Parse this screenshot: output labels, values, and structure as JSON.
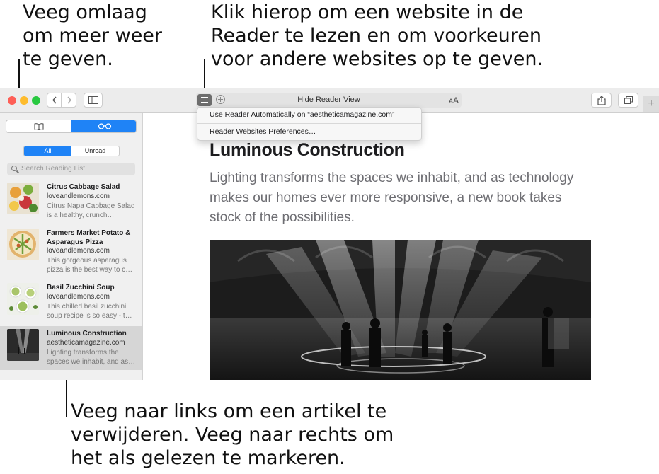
{
  "callouts": {
    "top_left": "Veeg omlaag om meer weer te geven.",
    "top_center": "Klik hierop om een website in de Reader te lezen en om voorkeuren voor andere websites op te geven.",
    "bottom": "Veeg naar links om een artikel te verwijderen. Veeg naar rechts om het als gelezen te markeren."
  },
  "toolbar": {
    "address_title": "Hide Reader View",
    "text_size_label": "AA",
    "icons": [
      "back-icon",
      "forward-icon",
      "sidebar-icon",
      "reader-icon",
      "add-icon",
      "share-icon",
      "tabs-icon",
      "new-tab-icon"
    ],
    "traffic_colors": {
      "close": "#fe5f57",
      "minimize": "#febc2e",
      "zoom": "#28c840"
    }
  },
  "reader_menu": {
    "items": [
      "Use Reader Automatically on “aestheticamagazine.com”",
      "Reader Websites Preferences…"
    ]
  },
  "sidebar": {
    "tabs": [
      "bookmarks-icon",
      "reading-list-icon"
    ],
    "filter": {
      "all": "All",
      "unread": "Unread"
    },
    "search_placeholder": "Search Reading List",
    "items": [
      {
        "title": "Citrus Cabbage Salad",
        "site": "loveandlemons.com",
        "excerpt": "Citrus Napa Cabbage Salad is a healthy, crunch…"
      },
      {
        "title": "Farmers Market Potato & Asparagus Pizza",
        "site": "loveandlemons.com",
        "excerpt": "This gorgeous asparagus pizza is the best way to c…"
      },
      {
        "title": "Basil Zucchini Soup",
        "site": "loveandlemons.com",
        "excerpt": "This chilled basil zucchini soup recipe is so easy - t…"
      },
      {
        "title": "Luminous Construction",
        "site": "aestheticamagazine.com",
        "excerpt": "Lighting transforms the spaces we inhabit, and as…"
      }
    ]
  },
  "article": {
    "title": "Luminous Construction",
    "subtitle": "Lighting transforms the spaces we inhabit, and as technology makes our homes ever more responsive, a new book takes stock of the possibilities."
  },
  "colors": {
    "accent": "#1f83f6",
    "reader_button": "#6d6d6d"
  }
}
